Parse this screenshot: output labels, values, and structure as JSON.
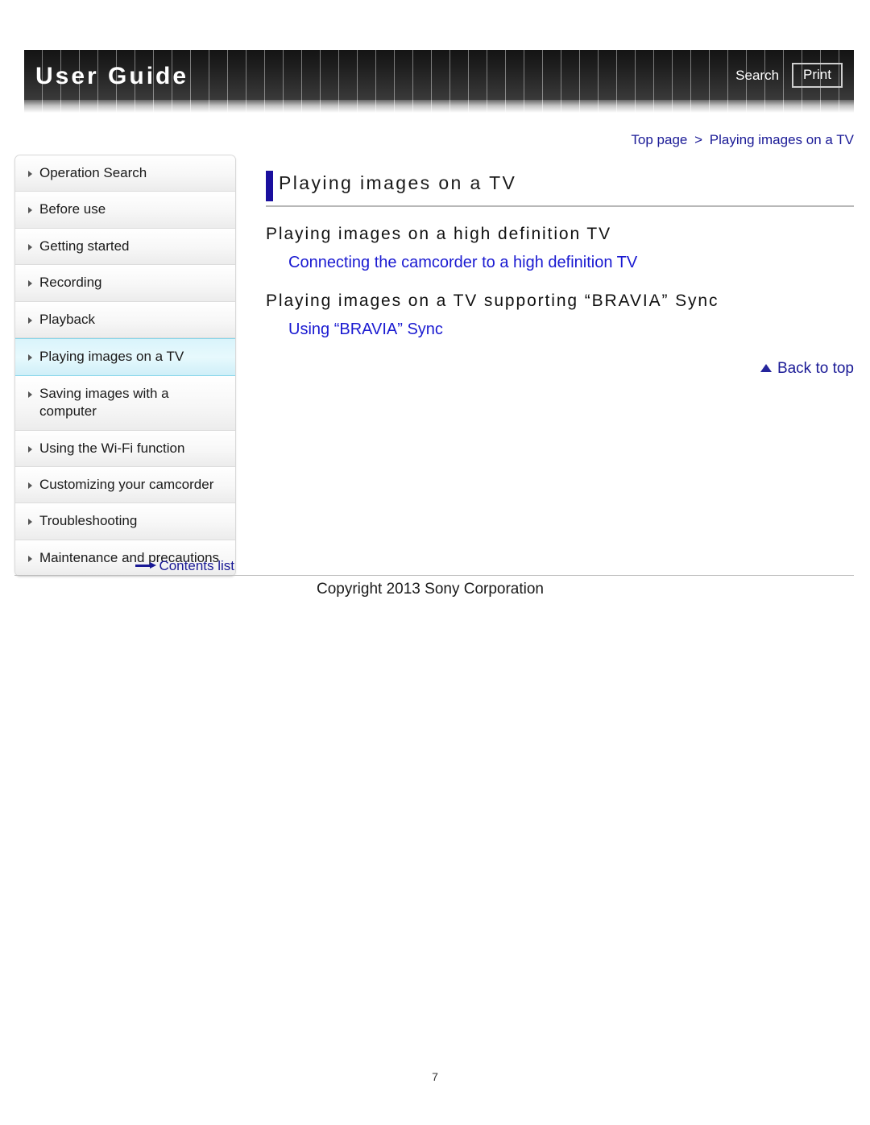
{
  "header": {
    "title": "User Guide",
    "search_label": "Search",
    "print_label": "Print"
  },
  "breadcrumb": {
    "top_label": "Top page",
    "separator": ">",
    "current_label": "Playing images on a TV"
  },
  "sidebar": {
    "items": [
      {
        "label": "Operation Search",
        "active": false
      },
      {
        "label": "Before use",
        "active": false
      },
      {
        "label": "Getting started",
        "active": false
      },
      {
        "label": "Recording",
        "active": false
      },
      {
        "label": "Playback",
        "active": false
      },
      {
        "label": "Playing images on a TV",
        "active": true
      },
      {
        "label": "Saving images with a computer",
        "active": false
      },
      {
        "label": "Using the Wi-Fi function",
        "active": false
      },
      {
        "label": "Customizing your camcorder",
        "active": false
      },
      {
        "label": "Troubleshooting",
        "active": false
      },
      {
        "label": "Maintenance and precautions",
        "active": false
      }
    ],
    "contents_list_label": "Contents list"
  },
  "main": {
    "page_title": "Playing images on a TV",
    "sections": [
      {
        "heading": "Playing images on a high definition TV",
        "link": "Connecting the camcorder to a high definition TV"
      },
      {
        "heading": "Playing images on a TV supporting “BRAVIA” Sync",
        "link": "Using “BRAVIA” Sync"
      }
    ],
    "back_to_top_label": "Back to top"
  },
  "footer": {
    "copyright": "Copyright 2013 Sony Corporation",
    "page_number": "7"
  },
  "colors": {
    "link_blue": "#1a1ad1",
    "nav_blue": "#1a1a96",
    "title_bar_blue": "#1a0f9e",
    "active_cyan": "#d9f4fb",
    "banner_dark": "#1d1d1d"
  }
}
